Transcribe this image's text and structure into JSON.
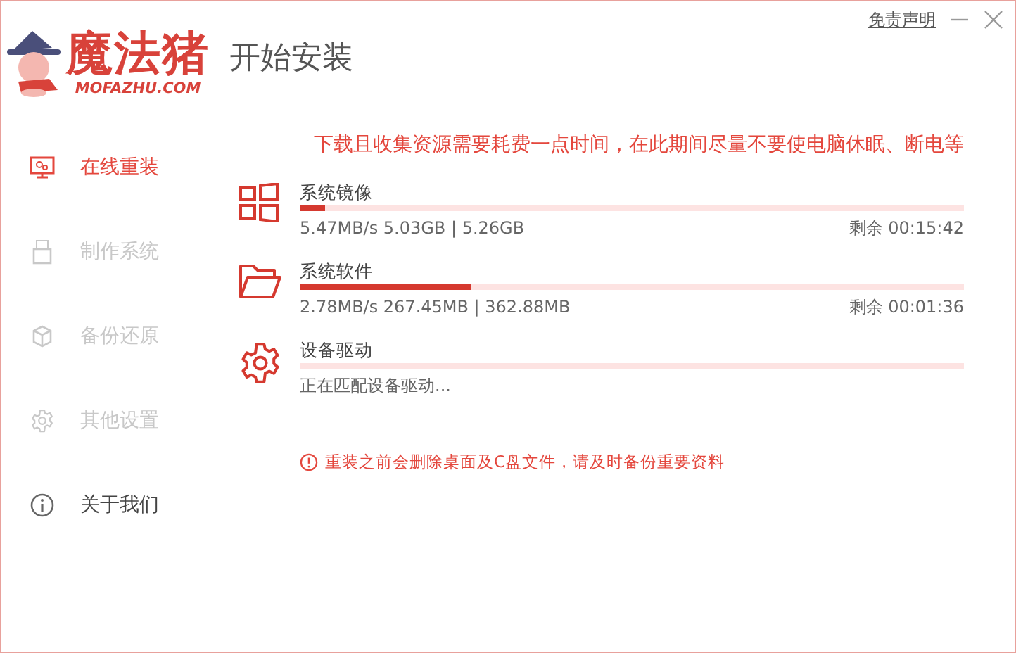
{
  "logo": {
    "name": "魔法猪",
    "domain": "MOFAZHU.COM"
  },
  "window": {
    "title": "开始安装",
    "disclaimer_link": "免责声明"
  },
  "sidebar": {
    "items": [
      {
        "label": "在线重装",
        "kind": "monitor",
        "selected": true,
        "disabled": false
      },
      {
        "label": "制作系统",
        "kind": "usb",
        "selected": false,
        "disabled": true
      },
      {
        "label": "备份还原",
        "kind": "cube",
        "selected": false,
        "disabled": true
      },
      {
        "label": "其他设置",
        "kind": "gear",
        "selected": false,
        "disabled": true
      },
      {
        "label": "关于我们",
        "kind": "info",
        "selected": false,
        "disabled": false
      }
    ]
  },
  "notice": "下载且收集资源需要耗费一点时间，在此期间尽量不要使电脑休眠、断电等",
  "tasks": [
    {
      "kind": "windows",
      "name": "系统镜像",
      "level": 0.038,
      "stats": "5.47MB/s 5.03GB | 5.26GB",
      "remaining": "剩余 00:15:42"
    },
    {
      "kind": "folder",
      "name": "系统软件",
      "level": 0.258,
      "stats": "2.78MB/s 267.45MB | 362.88MB",
      "remaining": "剩余 00:01:36"
    },
    {
      "kind": "gear",
      "name": "设备驱动",
      "level": 0,
      "stats": "正在匹配设备驱动..."
    }
  ],
  "warning": "重装之前会删除桌面及C盘文件，请及时备份重要资料"
}
